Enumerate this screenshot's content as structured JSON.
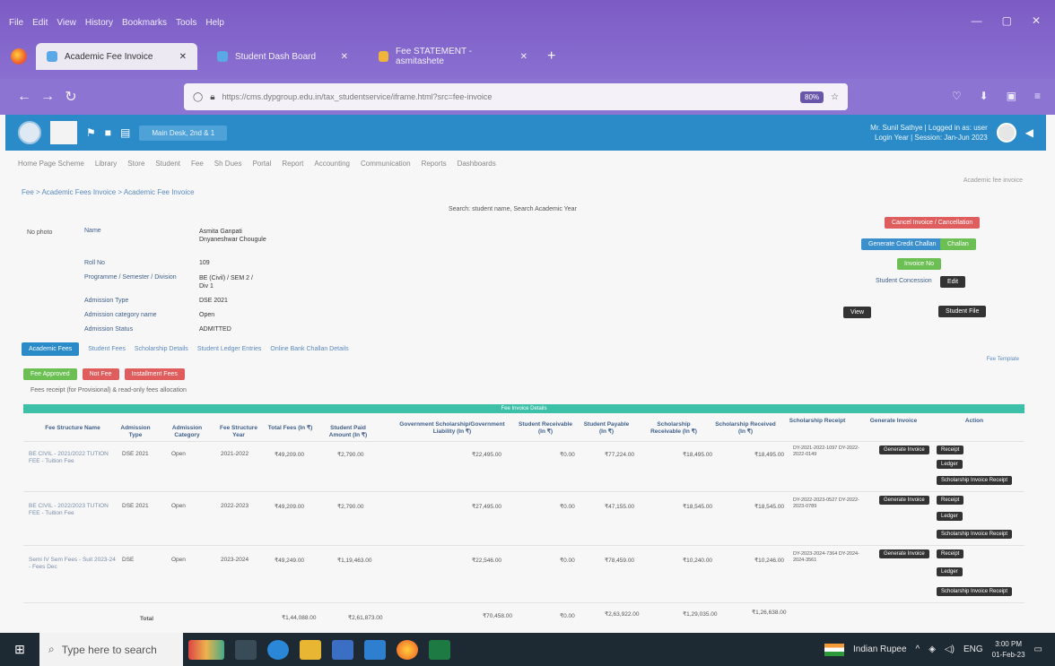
{
  "browser": {
    "menu": [
      "File",
      "Edit",
      "View",
      "History",
      "Bookmarks",
      "Tools",
      "Help"
    ],
    "tabs": [
      {
        "label": "Academic Fee Invoice",
        "active": true
      },
      {
        "label": "Student Dash Board",
        "active": false
      },
      {
        "label": "Fee STATEMENT - asmitashete",
        "active": false
      }
    ],
    "url": "https://cms.dypgroup.edu.in/tax_studentservice/iframe.html?src=fee-invoice",
    "zoom": "80%"
  },
  "app": {
    "session": "Main Desk, 2nd & 1",
    "user_line1": "Mr. Sunil Sathye | Logged in as: user",
    "user_line2": "Login Year | Session: Jan-Jun 2023"
  },
  "topmenu": [
    "Home Page Scheme",
    "Library",
    "Store",
    "Student",
    "Fee",
    "Sh Dues",
    "Portal",
    "Report",
    "Accounting",
    "Communication",
    "Reports",
    "Dashboards"
  ],
  "breadcrumb": "Fee > Academic Fees Invoice > Academic Fee Invoice",
  "crumb_right": "Academic fee invoice",
  "search_hint": "Search: student name, Search Academic Year",
  "student": {
    "photo_label": "No photo",
    "fields": [
      {
        "label": "Name",
        "value": "Asmita Ganpati Dnyaneshwar Chougule"
      },
      {
        "label": "Roll No",
        "value": "109"
      },
      {
        "label": "Programme / Semester / Division",
        "value": "BE (Civil) / SEM 2 / Div 1"
      },
      {
        "label": "Admission Type",
        "value": "DSE 2021"
      },
      {
        "label": "Admission category name",
        "value": "Open"
      },
      {
        "label": "Admission Status",
        "value": "ADMITTED"
      }
    ]
  },
  "actions": {
    "cancel_invoice": "Cancel Invoice / Cancellation",
    "generate_credit": "Generate Credit Challan",
    "challan": "Challan",
    "invoice": "Invoice No",
    "student_concession": "Student Concession",
    "edit": "Edit",
    "view": "View",
    "student_file": "Student File"
  },
  "subtabs": [
    "Academic Fees",
    "Student Fees",
    "Scholarship Details",
    "Student Ledger Entries",
    "Online Bank Challan Details"
  ],
  "filters": [
    "Fee Approved",
    "Not Fee",
    "Installment Fees"
  ],
  "note": "Fees receipt (for Provisional) & read-only fees allocation",
  "hint_right": "Fee Template",
  "table": {
    "title": "Fee Invoice Details",
    "headers": [
      "Fee Structure Name",
      "Admission Type",
      "Admission Category",
      "Fee Structure Year",
      "Total Fees (In ₹)",
      "Student Paid Amount (In ₹)",
      "Government Scholarship/Government Liability (In ₹)",
      "Student Receivable (In ₹)",
      "Student Payable (In ₹)",
      "Scholarship Receivable (In ₹)",
      "Scholarship Received (In ₹)",
      "Scholarship Receipt",
      "Generate Invoice",
      "Action"
    ],
    "rows": [
      {
        "name": "BE CIVIL - 2021/2022 TUTION FEE - Tuition Fee",
        "type": "DSE 2021",
        "cat": "Open",
        "year": "2021-2022",
        "total": "₹49,209.00",
        "paid": "₹2,790.00",
        "gov": "₹22,495.00",
        "recv": "₹0.00",
        "payable": "₹77,224.00",
        "sch_recv": "₹18,495.00",
        "sch_rcvd": "₹18,495.00",
        "receipt": "DY-2021-2022-1097 DY-2022-2022-0149"
      },
      {
        "name": "BE CIVIL - 2022/2023 TUTION FEE - Tuition Fee",
        "type": "DSE 2021",
        "cat": "Open",
        "year": "2022-2023",
        "total": "₹49,209.00",
        "paid": "₹2,790.00",
        "gov": "₹27,495.00",
        "recv": "₹0.00",
        "payable": "₹47,155.00",
        "sch_recv": "₹18,545.00",
        "sch_rcvd": "₹18,545.00",
        "receipt": "DY-2022-2023-0527 DY-2022-2023-0789"
      },
      {
        "name": "Semi IV Sem Fees - Suit 2023-24 - Fees Dec",
        "type": "DSE",
        "cat": "Open",
        "year": "2023-2024",
        "total": "₹49,249.00",
        "paid": "₹1,19,463.00",
        "gov": "₹22,546.00",
        "recv": "₹0.00",
        "payable": "₹78,459.00",
        "sch_recv": "₹10,240.00",
        "sch_rcvd": "₹10,246.00",
        "receipt": "DY-2023-2024-7364 DY-2024-2024-3561"
      }
    ],
    "total_label": "Total",
    "totals": {
      "total": "₹1,44,088.00",
      "paid": "₹2,61,873.00",
      "gov": "₹70,458.00",
      "recv": "₹0.00",
      "payable": "₹2,63,922.00",
      "sch_recv": "₹1,29,035.00",
      "sch_rcvd": "₹1,26,638.00"
    },
    "btn_generate": "Generate Invoice",
    "btn_receipt": "Receipt",
    "btn_ledger": "Ledger",
    "btn_sch_receipt": "Scholarship Invoice Receipt"
  },
  "taskbar": {
    "search_placeholder": "Type here to search",
    "currency": "Indian Rupee",
    "lang": "ENG",
    "time": "3:00 PM",
    "date": "01-Feb-23"
  }
}
